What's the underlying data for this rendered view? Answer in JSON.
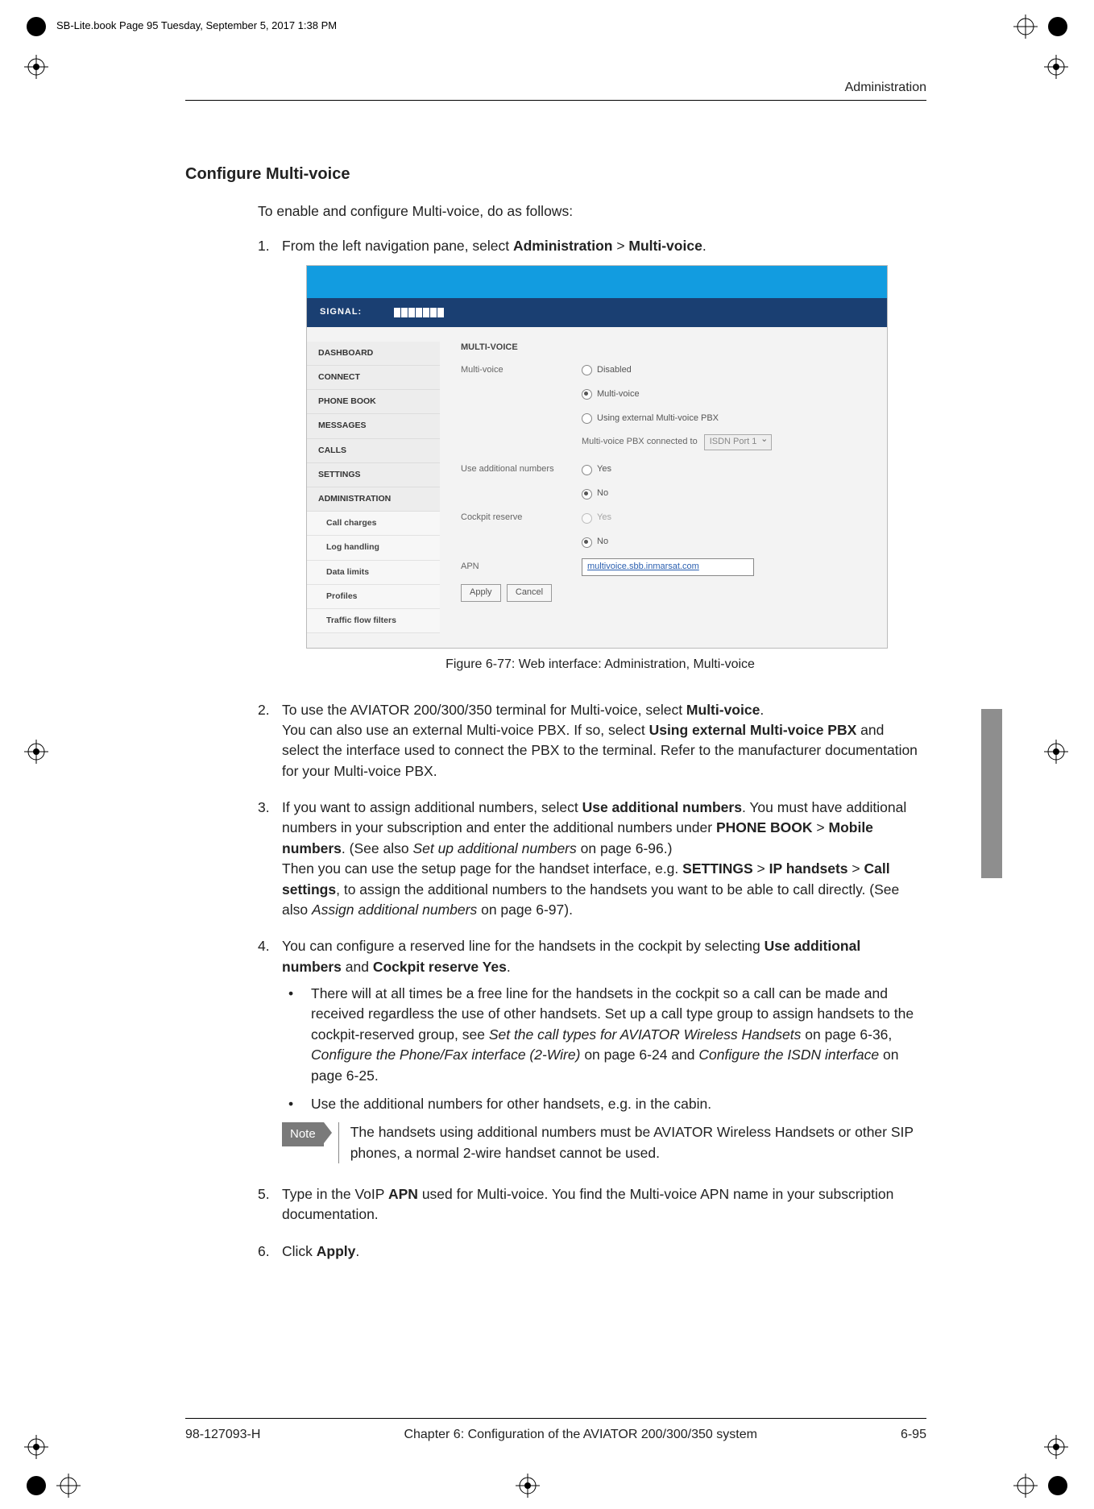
{
  "header_stamp": "SB-Lite.book  Page 95  Tuesday, September 5, 2017  1:38 PM",
  "running_head": "Administration",
  "section_heading": "Configure Multi-voice",
  "intro": "To enable and configure Multi-voice, do as follows:",
  "step1_prefix": "From the left navigation pane, select ",
  "step1_bold1": "Administration",
  "step1_sep": " > ",
  "step1_bold2": "Multi-voice",
  "step1_suffix": ".",
  "figure": {
    "signal_label": "SIGNAL:",
    "nav": {
      "items": [
        "DASHBOARD",
        "CONNECT",
        "PHONE BOOK",
        "MESSAGES",
        "CALLS",
        "SETTINGS",
        "ADMINISTRATION"
      ],
      "subitems": [
        "Call charges",
        "Log handling",
        "Data limits",
        "Profiles",
        "Traffic flow filters"
      ]
    },
    "panel_title": "MULTI-VOICE",
    "mv_label": "Multi-voice",
    "opts": {
      "disabled": "Disabled",
      "multi": "Multi-voice",
      "ext": "Using external Multi-voice PBX"
    },
    "pbx_label": "Multi-voice PBX connected to",
    "pbx_value": "ISDN Port 1",
    "use_add_label": "Use additional numbers",
    "cockpit_label": "Cockpit reserve",
    "yes": "Yes",
    "no": "No",
    "apn_label": "APN",
    "apn_value": "multivoice.sbb.inmarsat.com",
    "apply": "Apply",
    "cancel": "Cancel"
  },
  "figure_caption": "Figure 6-77: Web interface: Administration, Multi-voice",
  "step2": {
    "p1a": "To use the AVIATOR 200/300/350 terminal for Multi-voice, select ",
    "p1b": "Multi-voice",
    "p1c": ".",
    "p2a": "You can also use an external Multi-voice PBX. If so, select ",
    "p2b": "Using external Multi-voice PBX",
    "p2c": " and select the interface used to connect the PBX to the terminal. Refer to the manufacturer documentation for your Multi-voice PBX."
  },
  "step3": {
    "p1a": "If you want to assign additional numbers, select ",
    "p1b": "Use additional numbers",
    "p1c": ". You must have additional numbers in your subscription and enter the additional numbers under ",
    "p1d": "PHONE BOOK",
    "p1e": " > ",
    "p1f": "Mobile numbers",
    "p1g": ". (See also ",
    "p1h": "Set up additional numbers",
    "p1i": " on page 6-96.)",
    "p2a": "Then you can use the setup page for the handset interface, e.g. ",
    "p2b": "SETTINGS",
    "p2c": " > ",
    "p2d": "IP handsets",
    "p2e": " > ",
    "p2f": "Call settings",
    "p2g": ", to assign the additional numbers to the handsets you want to be able to call directly. (See also ",
    "p2h": "Assign additional numbers",
    "p2i": " on page 6-97)."
  },
  "step4": {
    "p1a": "You can configure a reserved line for the handsets in the cockpit by selecting ",
    "p1b": "Use additional numbers",
    "p1c": " and ",
    "p1d": "Cockpit reserve Yes",
    "p1e": ".",
    "b1a": "There will at all times be a free line for the handsets in the cockpit so a call can be made and received regardless the use of other handsets. Set up a call type group to assign handsets to the cockpit-reserved group, see ",
    "b1b": "Set the call types for AVIATOR Wireless Handsets",
    "b1c": " on page 6-36, ",
    "b1d": "Configure the Phone/Fax interface (2-Wire)",
    "b1e": " on page 6-24 and ",
    "b1f": "Configure the ISDN interface",
    "b1g": " on page 6-25.",
    "b2": "Use the additional numbers for other handsets, e.g. in the cabin."
  },
  "note_label": "Note",
  "note_text": "The handsets using additional numbers must be AVIATOR Wireless Handsets or other SIP phones, a normal 2-wire handset cannot be used.",
  "step5": {
    "a": "Type in the VoIP ",
    "b": "APN",
    "c": " used for Multi-voice. You find the Multi-voice APN name in your subscription documentation."
  },
  "step6": {
    "a": "Click ",
    "b": "Apply",
    "c": "."
  },
  "footer": {
    "left": "98-127093-H",
    "center": "Chapter 6:  Configuration of the AVIATOR 200/300/350 system",
    "right": "6-95"
  }
}
